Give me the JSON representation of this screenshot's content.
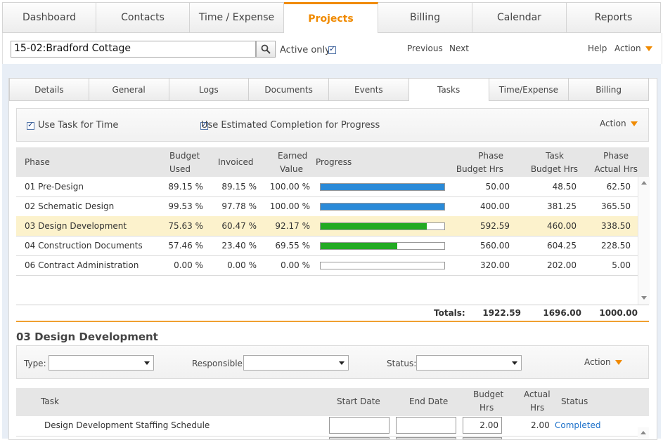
{
  "nav": {
    "tabs": [
      "Dashboard",
      "Contacts",
      "Time / Expense",
      "Projects",
      "Billing",
      "Calendar",
      "Reports"
    ],
    "active": "Projects"
  },
  "toolbar": {
    "search_value": "15-02:Bradford Cottage",
    "active_only_label": "Active only",
    "previous_label": "Previous",
    "next_label": "Next",
    "help_label": "Help",
    "action_label": "Action"
  },
  "subtabs": [
    "Details",
    "General",
    "Logs",
    "Documents",
    "Events",
    "Tasks",
    "Time/Expense",
    "Billing"
  ],
  "options": {
    "use_task_label": "Use Task for Time",
    "use_est_label": "Use Estimated Completion for Progress",
    "action_label": "Action"
  },
  "phase_headers": {
    "phase": "Phase",
    "budget_used_1": "Budget",
    "budget_used_2": "Used",
    "invoiced": "Invoiced",
    "earned_1": "Earned",
    "earned_2": "Value",
    "progress": "Progress",
    "pbh_1": "Phase",
    "pbh_2": "Budget Hrs",
    "tbh_1": "Task",
    "tbh_2": "Budget Hrs",
    "pah_1": "Phase",
    "pah_2": "Actual Hrs"
  },
  "phases": [
    {
      "name": "01 Pre-Design",
      "budget_used": "89.15 %",
      "invoiced": "89.15 %",
      "earned": "100.00 %",
      "progress": 1.0,
      "color": "#2a8ad8",
      "pbh": "50.00",
      "tbh": "48.50",
      "pah": "62.50"
    },
    {
      "name": "02 Schematic Design",
      "budget_used": "99.53 %",
      "invoiced": "97.78 %",
      "earned": "100.00 %",
      "progress": 1.0,
      "color": "#2a8ad8",
      "pbh": "400.00",
      "tbh": "381.25",
      "pah": "365.50"
    },
    {
      "name": "03 Design Development",
      "budget_used": "75.63 %",
      "invoiced": "60.47 %",
      "earned": "92.17 %",
      "progress": 0.86,
      "color": "#22aa22",
      "pbh": "592.59",
      "tbh": "460.00",
      "pah": "338.50"
    },
    {
      "name": "04 Construction Documents",
      "budget_used": "57.46 %",
      "invoiced": "23.40 %",
      "earned": "69.55 %",
      "progress": 0.62,
      "color": "#22aa22",
      "pbh": "560.00",
      "tbh": "604.25",
      "pah": "228.50"
    },
    {
      "name": "06 Contract Administration",
      "budget_used": "0.00 %",
      "invoiced": "0.00 %",
      "earned": "0.00 %",
      "progress": 0.0,
      "color": "#22aa22",
      "pbh": "320.00",
      "tbh": "202.00",
      "pah": "5.00"
    }
  ],
  "totals": {
    "label": "Totals:",
    "pbh": "1922.59",
    "tbh": "1696.00",
    "pah": "1000.00"
  },
  "section": {
    "title": "03 Design Development"
  },
  "filters": {
    "type_label": "Type:",
    "responsible_label": "Responsible:",
    "status_label": "Status:",
    "action_label": "Action"
  },
  "task_headers": {
    "task": "Task",
    "start": "Start Date",
    "end": "End Date",
    "bh_1": "Budget",
    "bh_2": "Hrs",
    "ah_1": "Actual",
    "ah_2": "Hrs",
    "status": "Status"
  },
  "tasks": [
    {
      "name": "Design Development Staffing Schedule",
      "start": "",
      "end": "",
      "budget": "2.00",
      "actual": "2.00",
      "status": "Completed"
    }
  ],
  "colors": {
    "accent": "#f08a00",
    "link": "#1a6fc9",
    "selected_row": "#fcf2cc"
  }
}
